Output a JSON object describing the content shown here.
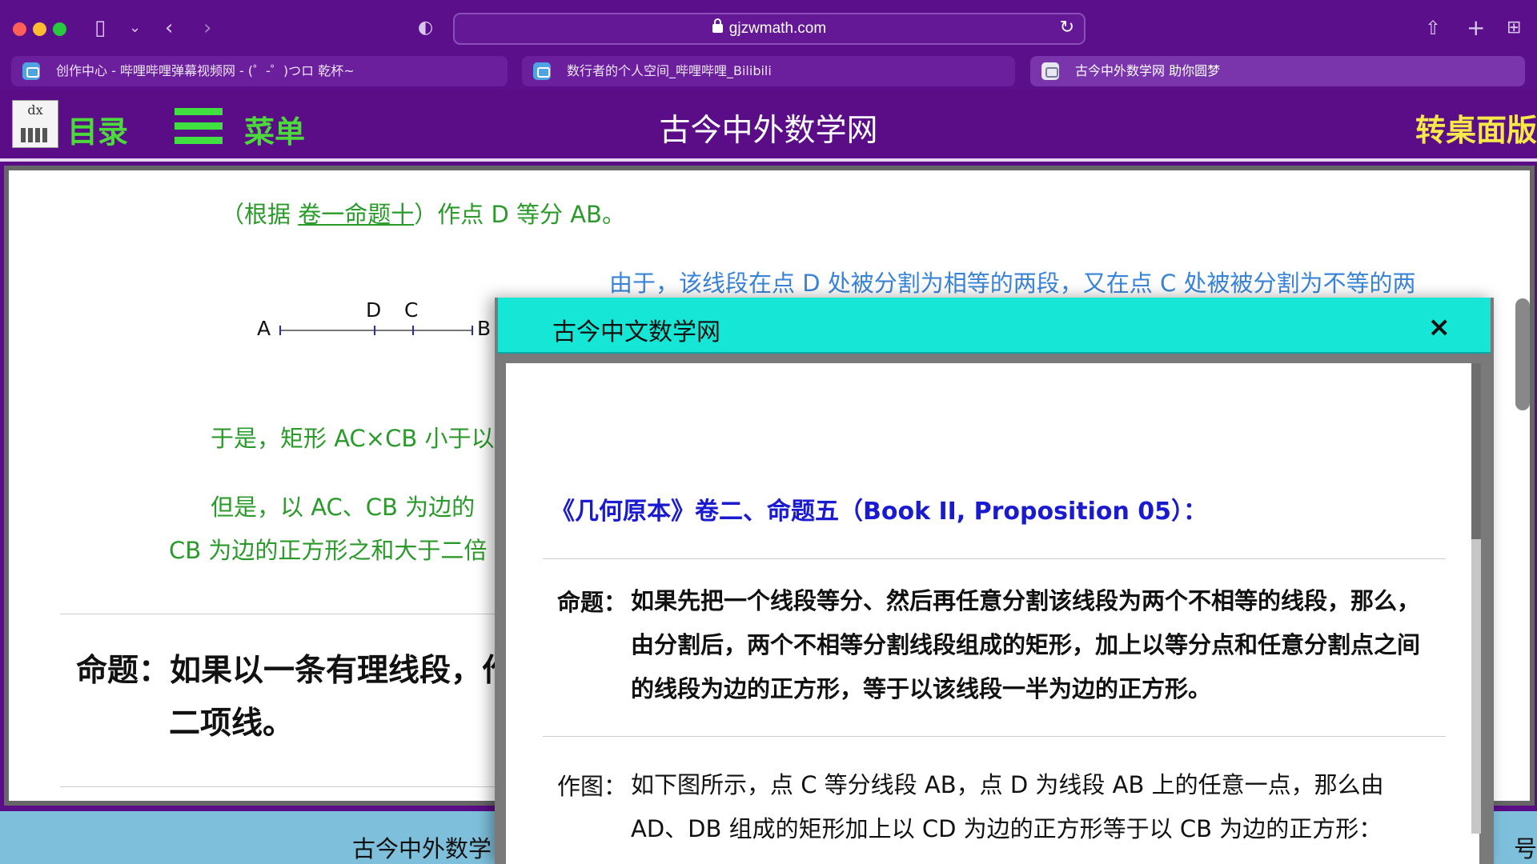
{
  "browser": {
    "url": "gjzwmath.com",
    "tabs": [
      {
        "label": "创作中心 - 哔哩哔哩弹幕视频网 - (゜-゜)つロ 乾杯~",
        "active": false,
        "icon": "bilibili-icon"
      },
      {
        "label": "数行者的个人空间_哔哩哔哩_Bilibili",
        "active": false,
        "icon": "bilibili-icon"
      },
      {
        "label": "古今中外数学网 助你圆梦",
        "active": true,
        "icon": "site-favicon"
      }
    ],
    "icons": [
      "sidebar-icon",
      "chevron-down-icon",
      "back-icon",
      "forward-icon",
      "privacy-shield-icon",
      "lock-icon",
      "reload-icon",
      "share-icon",
      "new-tab-icon",
      "tab-overview-icon"
    ]
  },
  "site": {
    "logo_text": "dx",
    "catalog": "目录",
    "menu": "菜单",
    "title": "古今中外数学网",
    "desktop": "转桌面版"
  },
  "page": {
    "line1_prefix": "（根据 ",
    "line1_link": "卷一命题十",
    "line1_suffix": "）作点 D 等分 AB。",
    "blue_line": "由于，该线段在点 D 处被分割为相等的两段，又在点 C 处被被分割为不等的两",
    "segment": {
      "a": "A",
      "d": "D",
      "c": "C",
      "b": "B"
    },
    "line_so": "于是，矩形 AC×CB 小于以",
    "line_but": "但是，以 AC、CB 为边的",
    "line_cb": "CB 为边的正方形之和大于二倍",
    "prop_line1": "命题：如果以一条有理线段，作",
    "prop_line2": "二项线。"
  },
  "footer": {
    "text": "古今中外数学",
    "right": "号"
  },
  "modal": {
    "title": "古今中文数学网",
    "close": "×",
    "heading": "《几何原本》卷二、命题五（Book II, Proposition 05）：",
    "prop_label": "命题：",
    "prop_text": "如果先把一个线段等分、然后再任意分割该线段为两个不相等的线段，那么，由分割后，两个不相等分割线段组成的矩形，加上以等分点和任意分割点之间的线段为边的正方形，等于以该线段一半为边的正方形。",
    "draw_label": "作图：",
    "draw_text": "如下图所示，点 C 等分线段 AB，点 D 为线段 AB 上的任意一点，那么由 AD、DB 组成的矩形加上以 CD 为边的正方形等于以 CB 为边的正方形："
  }
}
